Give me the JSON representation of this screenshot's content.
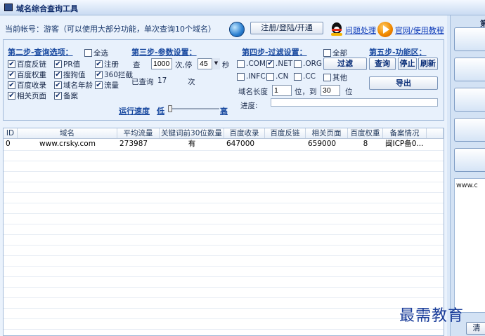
{
  "window": {
    "title": "域名综合查询工具"
  },
  "account": {
    "status_text": "当前帐号：游客（可以使用大部分功能，单次查询10个域名）",
    "register_button": "注册/登陆/开通",
    "help_link": "问题处理",
    "website_link": "官网/使用教程"
  },
  "step2": {
    "title": "第二步-查询选项：",
    "select_all": {
      "label": "全选",
      "checked": false
    },
    "options": [
      {
        "label": "百度反链",
        "checked": true
      },
      {
        "label": "PR值",
        "checked": true
      },
      {
        "label": "注册",
        "checked": true
      },
      {
        "label": "百度权重",
        "checked": true
      },
      {
        "label": "搜狗值",
        "checked": true
      },
      {
        "label": "360拦截",
        "checked": true
      },
      {
        "label": "百度收录",
        "checked": true
      },
      {
        "label": "域名年龄",
        "checked": true
      },
      {
        "label": "流量",
        "checked": true
      },
      {
        "label": "相关页面",
        "checked": true
      },
      {
        "label": "备案",
        "checked": true
      }
    ]
  },
  "step3": {
    "title": "第三步-参数设置：",
    "query_prefix": "查",
    "batch_count": "1000",
    "pause_label": "次,停",
    "pause_seconds": "45",
    "seconds_unit": "秒",
    "queried_label": "已查询",
    "queried_count": "17",
    "times_unit": "次",
    "speed_label": "运行速度",
    "speed_low": "低",
    "speed_high": "高",
    "speed_value": 0
  },
  "step4": {
    "title": "第四步-过滤设置：",
    "select_all": {
      "label": "全部",
      "checked": false
    },
    "tlds": [
      {
        "label": ".COM",
        "checked": false
      },
      {
        "label": ".NET",
        "checked": true
      },
      {
        "label": ".ORG",
        "checked": false
      },
      {
        "label": ".INFC",
        "checked": false
      },
      {
        "label": ".CN",
        "checked": false
      },
      {
        "label": ".CC",
        "checked": false
      },
      {
        "label": "其他",
        "checked": false
      }
    ],
    "filter_button": "过滤",
    "length_label": "域名长度",
    "length_min": "1",
    "length_to": "位，到",
    "length_max": "30",
    "length_unit": "位",
    "progress_label": "进度:",
    "progress_value": 0
  },
  "step5": {
    "title": "第五步-功能区：",
    "query_button": "查询",
    "stop_button": "停止",
    "refresh_button": "刷新",
    "export_button": "导出"
  },
  "table": {
    "columns": [
      "ID",
      "域名",
      "平均流量",
      "关键词前30位数量",
      "百度收录",
      "百度反链",
      "相关页面",
      "百度权重",
      "备案情况"
    ],
    "rows": [
      [
        "0",
        "www.crsky.com",
        "273987",
        "有",
        "647000",
        "",
        "659000",
        "8",
        "闽ICP备0..."
      ]
    ]
  },
  "right_panel": {
    "text_content": "www.c",
    "partial_top_label": "第",
    "partial_button_label": "清"
  },
  "watermark": "最需教育"
}
